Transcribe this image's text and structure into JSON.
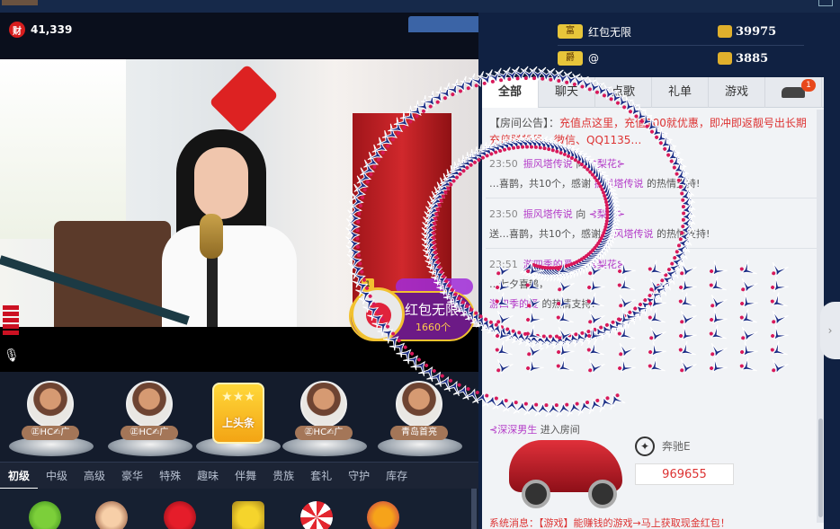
{
  "room": {
    "wealth_icon": "财",
    "wealth_value": "41,339"
  },
  "redpacket": {
    "title": "红包无限",
    "count": "1660个",
    "level": "1"
  },
  "seats": [
    {
      "tag": "㊣HC✍广"
    },
    {
      "tag": "㊣HC✍广"
    },
    {
      "tag": "上头条"
    },
    {
      "tag": "㊣HC✍广"
    },
    {
      "tag": "青岛首亮"
    }
  ],
  "gift_tabs": [
    "初级",
    "中级",
    "高级",
    "豪华",
    "特殊",
    "趣味",
    "伴舞",
    "贵族",
    "套礼",
    "守护",
    "库存"
  ],
  "ranking": [
    {
      "badge": "富",
      "name": "红包无限",
      "value": "39975"
    },
    {
      "badge": "爵",
      "name": "@",
      "value": "3885"
    }
  ],
  "chat_tabs": [
    "全部",
    "聊天",
    "点歌",
    "礼单",
    "游戏"
  ],
  "car_badge": "1",
  "announcement": {
    "label": "【房间公告】：",
    "text": "充值点这里，充值100就优惠，即冲即返靓号出长期充值赠靓号、微信、QQ1135…"
  },
  "messages": [
    {
      "time": "23:50",
      "user": "振风塔传说",
      "verb": "向",
      "target": "⊰梨花⊱",
      "rest": "…喜鹊，共10个，感谢",
      "sponsor": "振风塔传说",
      "end": "的热情支持!"
    },
    {
      "time": "23:50",
      "user": "振风塔传说",
      "verb": "向",
      "target": "⊰梨花⊱",
      "rest": "送…喜鹊，共10个，感谢",
      "sponsor": "振风塔传说",
      "end": "的热情支持!"
    },
    {
      "time": "23:51",
      "user": "游四季的爱",
      "verb": "向",
      "target": "⊰梨花⊱",
      "rest": "…七夕喜鹊，",
      "sponsor": "游四季的爱",
      "end": "的热情支持!"
    }
  ],
  "enter": {
    "user": "⊰深深男生",
    "text": "进入房间"
  },
  "car": {
    "brand": "奔驰E",
    "price": "969655"
  },
  "bottom_msg": "系统消息：【游戏】能赚钱的游戏→马上获取现金红包！"
}
